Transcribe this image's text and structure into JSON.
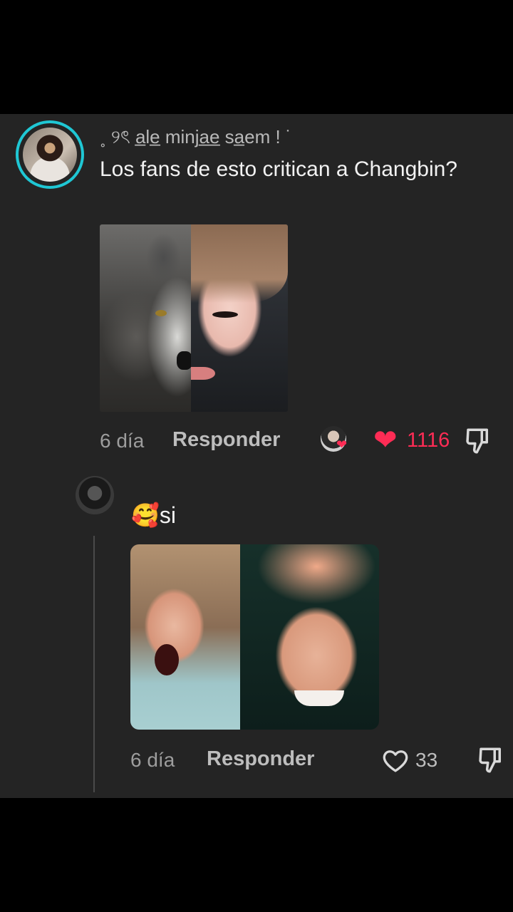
{
  "comment": {
    "username": "˳ ୨ৎ a̲le̲ minja̲e̲ sa̲em ! ˙",
    "text": "Los fans de esto critican a Changbin?",
    "age": "6 día",
    "reply_label": "Responder",
    "likes": "1116",
    "liked": true
  },
  "reply": {
    "emoji": "🥰",
    "text": "si",
    "age": "6 día",
    "reply_label": "Responder",
    "likes": "33",
    "liked": false
  },
  "colors": {
    "background": "#242424",
    "like_red": "#fe2c55",
    "avatar_ring": "#1fc7d4"
  },
  "icons": [
    "heart-filled-icon",
    "heart-outline-icon",
    "dislike-icon"
  ]
}
